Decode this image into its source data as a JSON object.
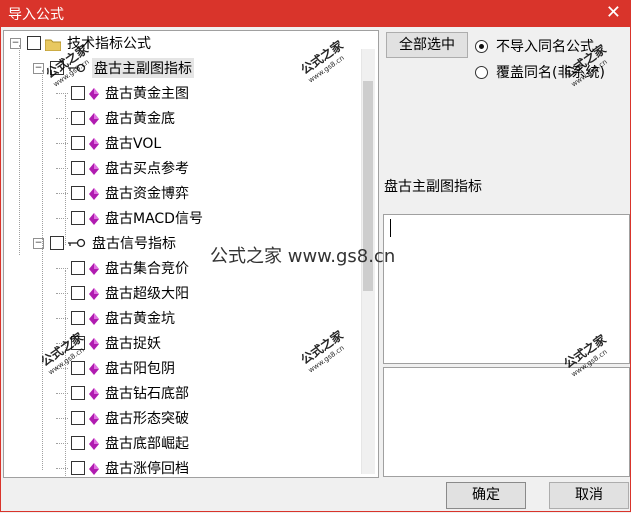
{
  "window": {
    "title": "导入公式",
    "close_icon": "close-icon"
  },
  "tree": {
    "root": {
      "label": "技术指标公式",
      "icon": "folder-icon"
    },
    "groups": [
      {
        "label": "盘古主副图指标",
        "icon": "key-icon",
        "items": [
          "盘古黄金主图",
          "盘古黄金底",
          "盘古VOL",
          "盘古买点参考",
          "盘古资金博弈",
          "盘古MACD信号"
        ]
      },
      {
        "label": "盘古信号指标",
        "icon": "key-icon",
        "items": [
          "盘古集合竞价",
          "盘古超级大阳",
          "盘古黄金坑",
          "盘古捉妖",
          "盘古阳包阴",
          "盘古钻石底部",
          "盘古形态突破",
          "盘古底部崛起",
          "盘古涨停回档"
        ]
      }
    ]
  },
  "options": {
    "select_all_label": "全部选中",
    "radio_skip_label": "不导入同名公式",
    "radio_overwrite_label": "覆盖同名(非系统)",
    "radio_selected": "skip"
  },
  "info": {
    "selected_name": "盘古主副图指标"
  },
  "footer": {
    "ok_label": "确定",
    "cancel_label": "取消"
  },
  "watermark": {
    "text": "公式之家",
    "url": "www.gs8.cn",
    "center_text": "公式之家 www.gs8.cn"
  },
  "colors": {
    "titlebar": "#d9342b",
    "gem": "#b01bb0"
  }
}
